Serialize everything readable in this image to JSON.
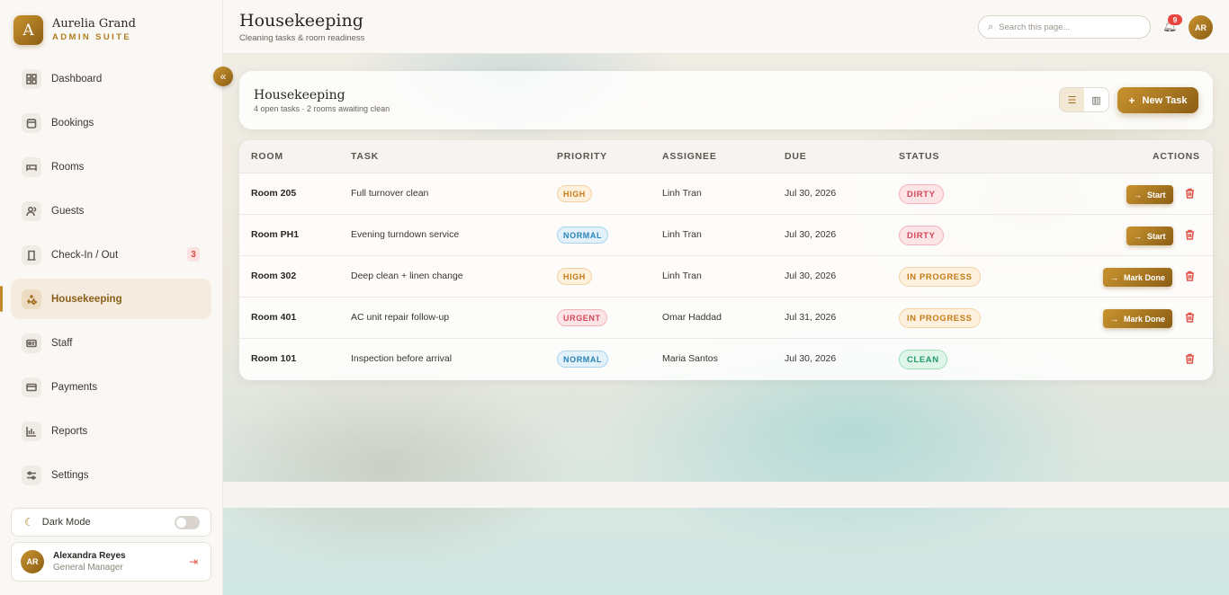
{
  "brand": {
    "logo_letter": "A",
    "name": "Aurelia Grand",
    "subtitle": "ADMIN SUITE",
    "accent": "#b07d22"
  },
  "sidebar": {
    "collapse_glyph": "«",
    "items": [
      {
        "label": "Dashboard",
        "icon": "dashboard-icon"
      },
      {
        "label": "Bookings",
        "icon": "calendar-icon"
      },
      {
        "label": "Rooms",
        "icon": "bed-icon"
      },
      {
        "label": "Guests",
        "icon": "users-icon"
      },
      {
        "label": "Check-In / Out",
        "icon": "door-icon",
        "badge": "3"
      },
      {
        "label": "Housekeeping",
        "icon": "sparkle-icon",
        "active": true
      },
      {
        "label": "Staff",
        "icon": "id-card-icon"
      },
      {
        "label": "Payments",
        "icon": "credit-card-icon"
      },
      {
        "label": "Reports",
        "icon": "bar-chart-icon"
      },
      {
        "label": "Settings",
        "icon": "sliders-icon"
      }
    ],
    "dark_mode_label": "Dark Mode",
    "dark_mode_on": false,
    "user": {
      "initials": "AR",
      "name": "Alexandra Reyes",
      "role": "General Manager"
    }
  },
  "header": {
    "title": "Housekeeping",
    "subtitle": "Cleaning tasks & room readiness",
    "search_placeholder": "Search this page...",
    "notification_count": "9",
    "avatar_initials": "AR"
  },
  "panel": {
    "title": "Housekeeping",
    "subtitle": "4 open tasks · 2 rooms awaiting clean",
    "new_task_label": "New Task"
  },
  "table": {
    "columns": [
      "ROOM",
      "TASK",
      "PRIORITY",
      "ASSIGNEE",
      "DUE",
      "STATUS",
      "ACTIONS"
    ],
    "rows": [
      {
        "room": "Room 205",
        "task": "Full turnover clean",
        "priority": "HIGH",
        "assignee": "Linh Tran",
        "due": "Jul 30, 2026",
        "status": "DIRTY",
        "action": "Start"
      },
      {
        "room": "Room PH1",
        "task": "Evening turndown service",
        "priority": "NORMAL",
        "assignee": "Linh Tran",
        "due": "Jul 30, 2026",
        "status": "DIRTY",
        "action": "Start"
      },
      {
        "room": "Room 302",
        "task": "Deep clean + linen change",
        "priority": "HIGH",
        "assignee": "Linh Tran",
        "due": "Jul 30, 2026",
        "status": "IN PROGRESS",
        "action": "Mark Done"
      },
      {
        "room": "Room 401",
        "task": "AC unit repair follow-up",
        "priority": "URGENT",
        "assignee": "Omar Haddad",
        "due": "Jul 31, 2026",
        "status": "IN PROGRESS",
        "action": "Mark Done"
      },
      {
        "room": "Room 101",
        "task": "Inspection before arrival",
        "priority": "NORMAL",
        "assignee": "Maria Santos",
        "due": "Jul 30, 2026",
        "status": "CLEAN",
        "action": ""
      }
    ]
  }
}
